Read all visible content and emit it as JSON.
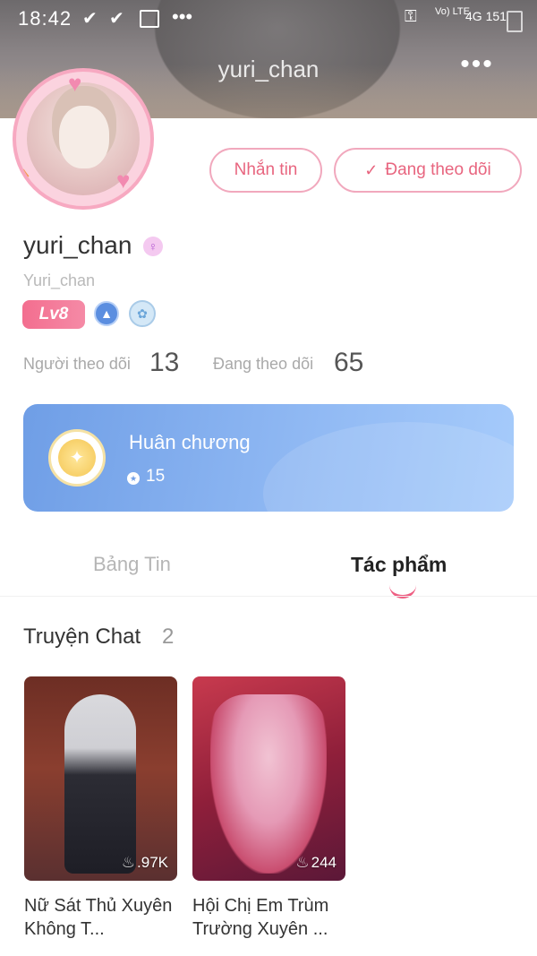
{
  "status_bar": {
    "time": "18:42",
    "network": "Vo) LTE",
    "signal": "4G 151"
  },
  "header": {
    "title": "yuri_chan",
    "more_label": "•••"
  },
  "actions": {
    "message_label": "Nhắn tin",
    "following_label": "Đang theo dõi"
  },
  "profile": {
    "name": "yuri_chan",
    "handle": "Yuri_chan",
    "level": "Lv8"
  },
  "stats": {
    "followers_label": "Người theo dõi",
    "followers_count": "13",
    "following_label": "Đang theo dõi",
    "following_count": "65"
  },
  "medals": {
    "title": "Huân chương",
    "count": "15"
  },
  "tabs": [
    {
      "label": "Bảng Tin",
      "active": false
    },
    {
      "label": "Tác phẩm",
      "active": true
    }
  ],
  "section": {
    "title": "Truyện Chat",
    "count": "2"
  },
  "stories": [
    {
      "title": "Nữ Sát Thủ Xuyên Không T...",
      "views": ".97K"
    },
    {
      "title": "Hội Chị Em Trùm Trường Xuyên ...",
      "views": "244"
    }
  ],
  "colors": {
    "accent": "#ee5e82",
    "button_border": "#f1a8bd",
    "medal_card": "#7fa9ec"
  }
}
